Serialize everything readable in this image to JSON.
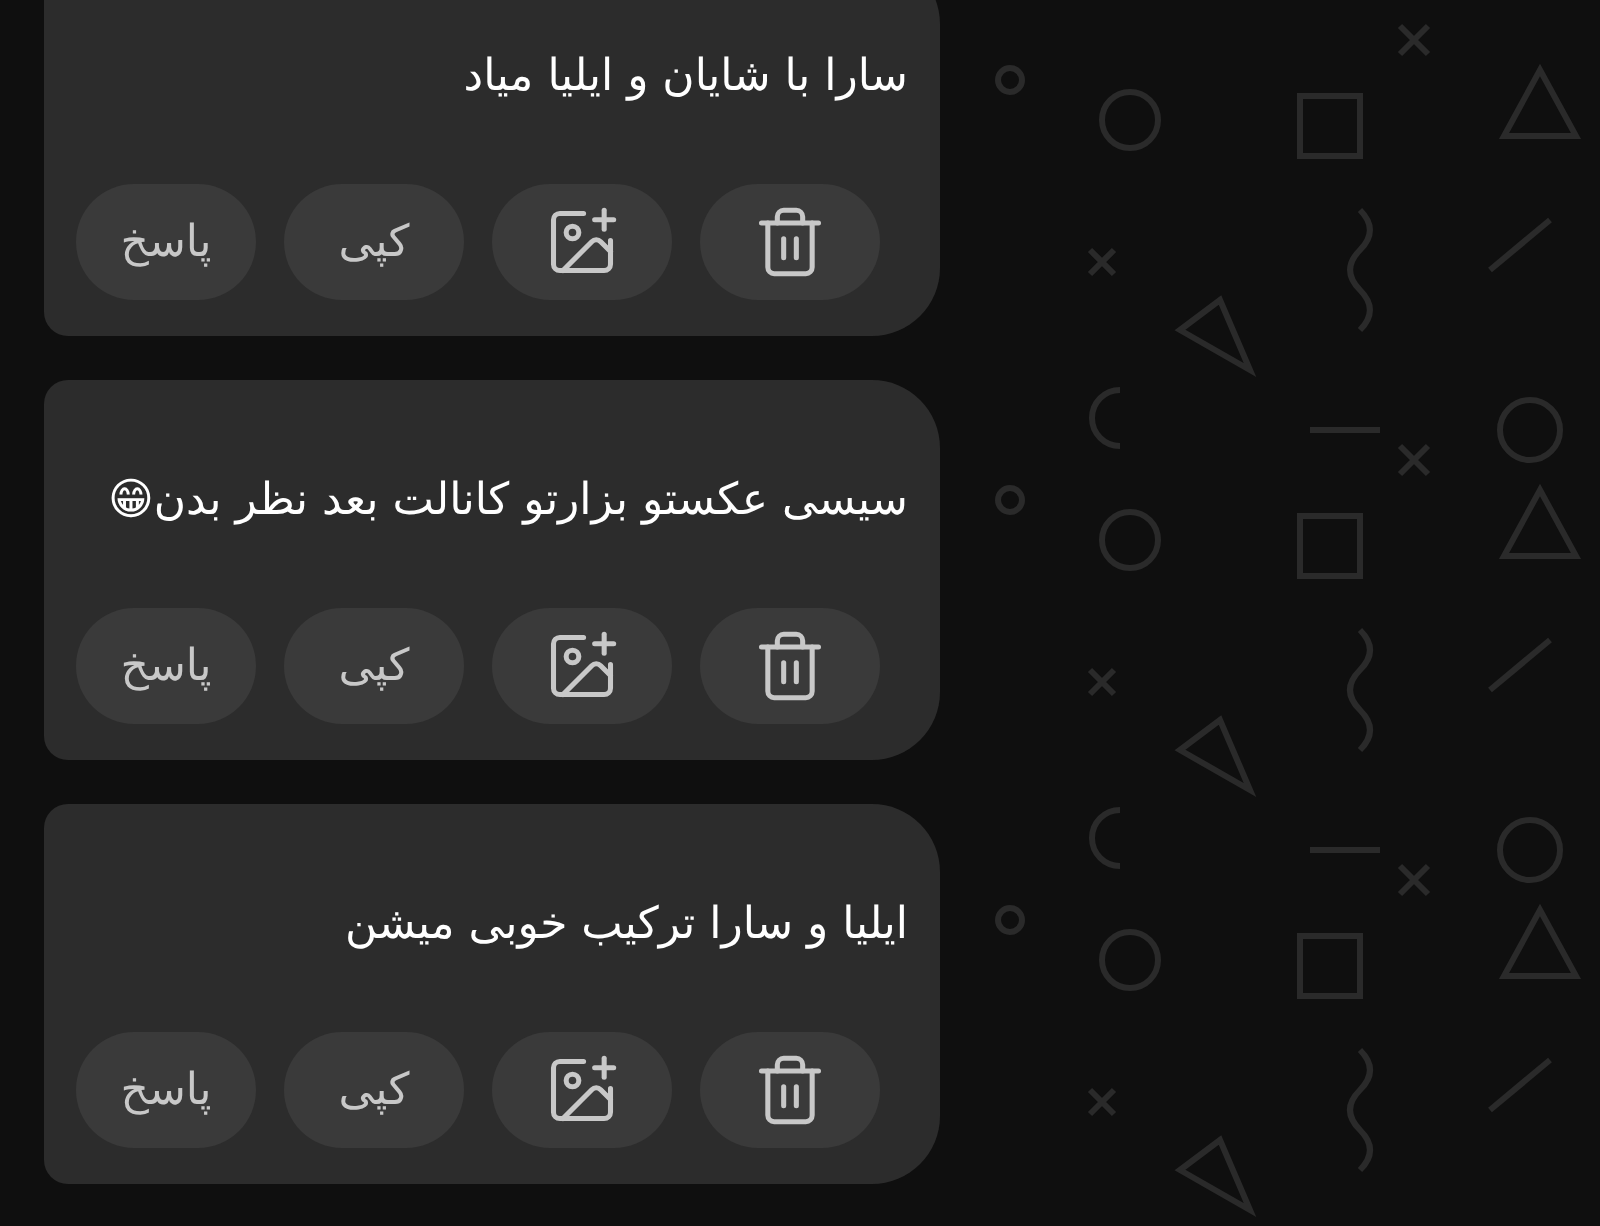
{
  "messages": [
    {
      "text": "سارا با شایان و ایلیا میاد",
      "actions": [
        {
          "kind": "delete"
        },
        {
          "kind": "add-image"
        },
        {
          "kind": "copy",
          "label": "کپی"
        },
        {
          "kind": "reply",
          "label": "پاسخ"
        }
      ]
    },
    {
      "text": "سیسی عکستو بزارتو کانالت بعد نظر بدن😁",
      "actions": [
        {
          "kind": "delete"
        },
        {
          "kind": "add-image"
        },
        {
          "kind": "copy",
          "label": "کپی"
        },
        {
          "kind": "reply",
          "label": "پاسخ"
        }
      ]
    },
    {
      "text": "ایلیا و سارا ترکیب خوبی میشن",
      "actions": [
        {
          "kind": "delete"
        },
        {
          "kind": "add-image"
        },
        {
          "kind": "copy",
          "label": "کپی"
        },
        {
          "kind": "reply",
          "label": "پاسخ"
        }
      ]
    }
  ]
}
